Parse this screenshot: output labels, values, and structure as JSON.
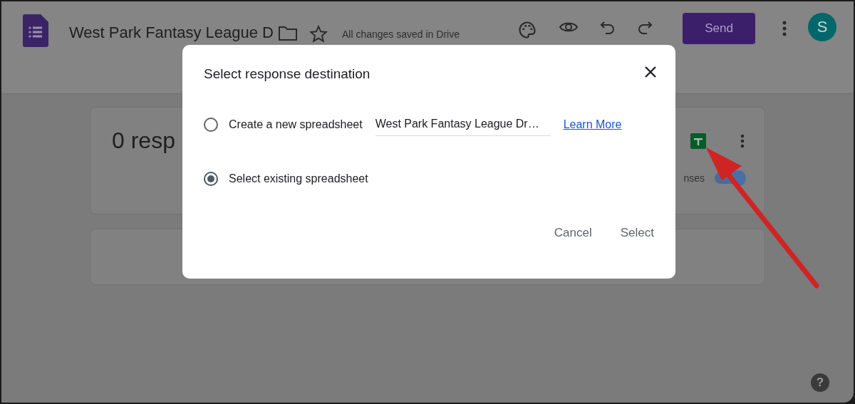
{
  "header": {
    "title": "West Park Fantasy League D",
    "save_status": "All changes saved in Drive",
    "send_button": "Send",
    "avatar": "S"
  },
  "responses_card": {
    "count_text": "0 resp",
    "accepting_label": "nses",
    "accepting_on": true
  },
  "dialog": {
    "title": "Select response destination",
    "options": [
      {
        "kind": "field",
        "label": "Create a new spreadsheet",
        "selected": false,
        "value": "West Park Fantasy League Dr…",
        "link": "Learn More"
      },
      {
        "kind": "plain",
        "label": "Select existing spreadsheet",
        "selected": true
      }
    ],
    "buttons": [
      "Cancel",
      "Select"
    ]
  },
  "help": "?"
}
